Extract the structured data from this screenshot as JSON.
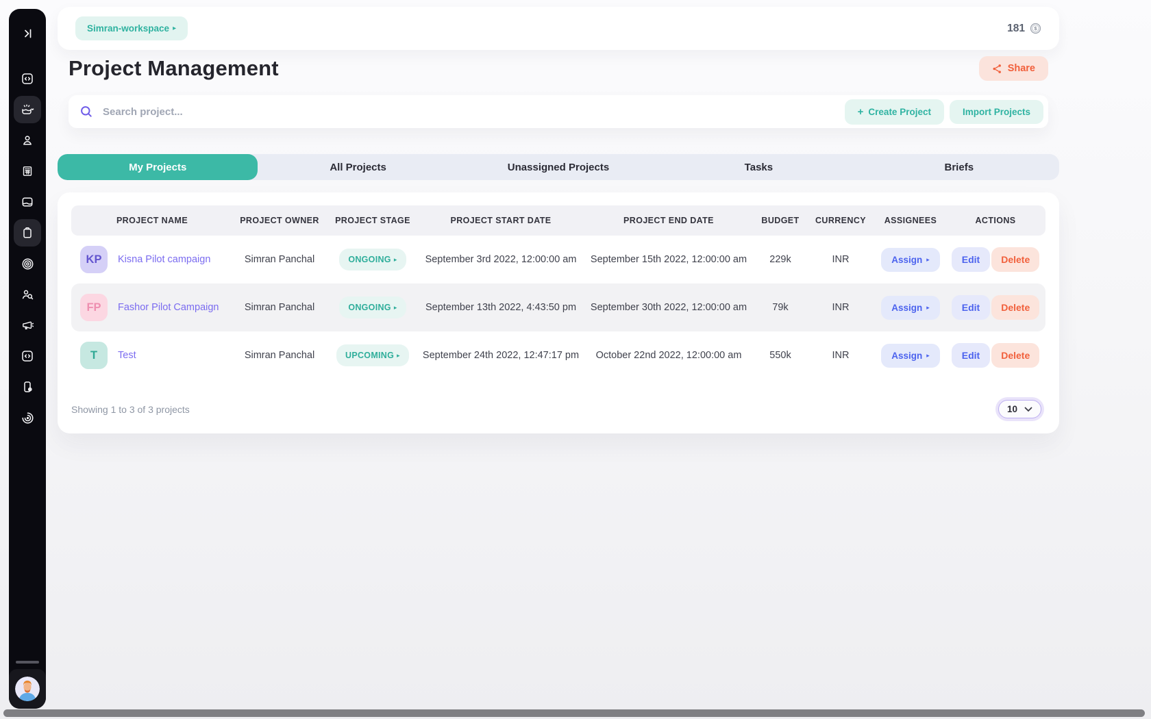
{
  "colors": {
    "accent_teal": "#3cb9a6",
    "accent_purple": "#7b6cf0",
    "accent_blue": "#4c63ee",
    "accent_coral": "#f1603c",
    "sidebar_bg": "#0a0a10"
  },
  "sidebar": {
    "icon_names": [
      "collapse-icon",
      "code-icon",
      "tray-sparkle-icon",
      "person-icon",
      "building-icon",
      "inbox-monitor-icon",
      "clipboard-icon",
      "target-icon",
      "person-search-icon",
      "megaphone-icon",
      "code-icon",
      "phone-gear-icon",
      "spiral-icon",
      "user-avatar"
    ]
  },
  "topbar": {
    "workspace": "Simran-workspace",
    "credits": "181"
  },
  "header": {
    "title": "Project Management",
    "share": "Share"
  },
  "toolbar": {
    "search_placeholder": "Search project...",
    "create": "Create Project",
    "import": "Import Projects"
  },
  "tabs": [
    {
      "label": "My Projects"
    },
    {
      "label": "All Projects"
    },
    {
      "label": "Unassigned Projects"
    },
    {
      "label": "Tasks"
    },
    {
      "label": "Briefs"
    }
  ],
  "table": {
    "columns": [
      "PROJECT NAME",
      "PROJECT OWNER",
      "PROJECT STAGE",
      "PROJECT START DATE",
      "PROJECT END DATE",
      "BUDGET",
      "CURRENCY",
      "ASSIGNEES",
      "ACTIONS"
    ],
    "actions": {
      "assign": "Assign",
      "edit": "Edit",
      "delete": "Delete"
    },
    "rows": [
      {
        "initials": "KP",
        "avatar_bg": "#d5d0f7",
        "avatar_text": "#6355cf",
        "name": "Kisna Pilot campaign",
        "owner": "Simran Panchal",
        "stage": "ONGOING",
        "start": "September 3rd 2022, 12:00:00 am",
        "end": "September 15th 2022, 12:00:00 am",
        "budget": "229k",
        "currency": "INR"
      },
      {
        "initials": "FP",
        "avatar_bg": "#fcd7e2",
        "avatar_text": "#ee8fb0",
        "name": "Fashor Pilot Campaign",
        "owner": "Simran Panchal",
        "stage": "ONGOING",
        "start": "September 13th 2022, 4:43:50 pm",
        "end": "September 30th 2022, 12:00:00 am",
        "budget": "79k",
        "currency": "INR"
      },
      {
        "initials": "T",
        "avatar_bg": "#c6e8e1",
        "avatar_text": "#2fa894",
        "name": "Test",
        "owner": "Simran Panchal",
        "stage": "UPCOMING",
        "start": "September 24th 2022, 12:47:17 pm",
        "end": "October 22nd 2022, 12:00:00 am",
        "budget": "550k",
        "currency": "INR"
      }
    ],
    "footer": {
      "showing": "Showing 1 to 3 of 3 projects",
      "page_size": "10"
    }
  }
}
